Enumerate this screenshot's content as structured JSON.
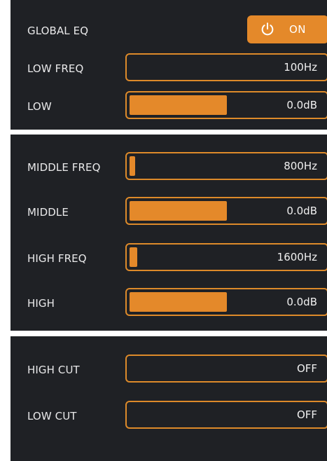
{
  "accent_color": "#e4892a",
  "panel_color": "#1f2125",
  "global_eq": {
    "label": "GLOBAL EQ",
    "state": "ON",
    "icon": "power-icon"
  },
  "low_freq": {
    "label": "LOW FREQ",
    "value": "100Hz",
    "level": 0.0
  },
  "low": {
    "label": "LOW",
    "value": "0.0dB",
    "level": 0.5
  },
  "middle_freq": {
    "label": "MIDDLE FREQ",
    "value": "800Hz",
    "level": 0.03
  },
  "middle": {
    "label": "MIDDLE",
    "value": "0.0dB",
    "level": 0.5
  },
  "high_freq": {
    "label": "HIGH FREQ",
    "value": "1600Hz",
    "level": 0.04
  },
  "high": {
    "label": "HIGH",
    "value": "0.0dB",
    "level": 0.5
  },
  "high_cut": {
    "label": "HIGH CUT",
    "value": "OFF",
    "level": 0.0
  },
  "low_cut": {
    "label": "LOW CUT",
    "value": "OFF",
    "level": 0.0
  }
}
